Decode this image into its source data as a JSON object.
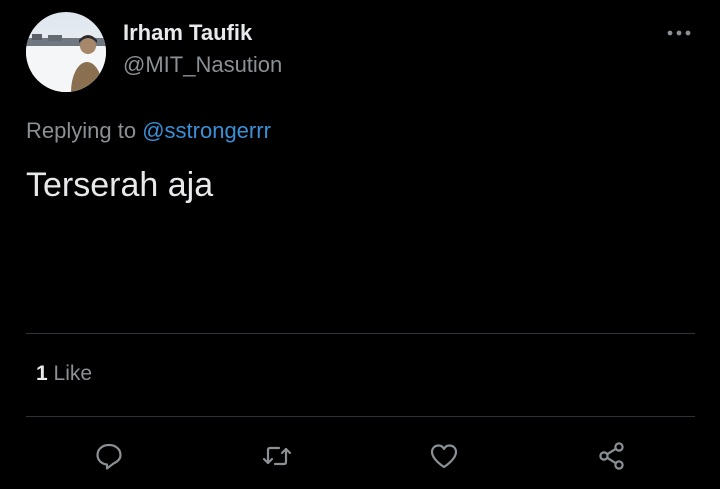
{
  "tweet": {
    "author": {
      "display_name": "Irham Taufik",
      "handle": "@MIT_Nasution"
    },
    "reply": {
      "prefix": "Replying to",
      "to_handle": "@sstrongerrr"
    },
    "text": "Terserah aja",
    "likes": {
      "count": "1",
      "label": "Like"
    }
  },
  "actions": {
    "icons": [
      "reply-icon",
      "retweet-icon",
      "like-icon",
      "share-icon"
    ]
  },
  "colors": {
    "background": "#000000",
    "primary_text": "#e7e9ea",
    "secondary_text": "#8b9094",
    "link": "#3b8fd6",
    "divider": "#2f3336"
  }
}
